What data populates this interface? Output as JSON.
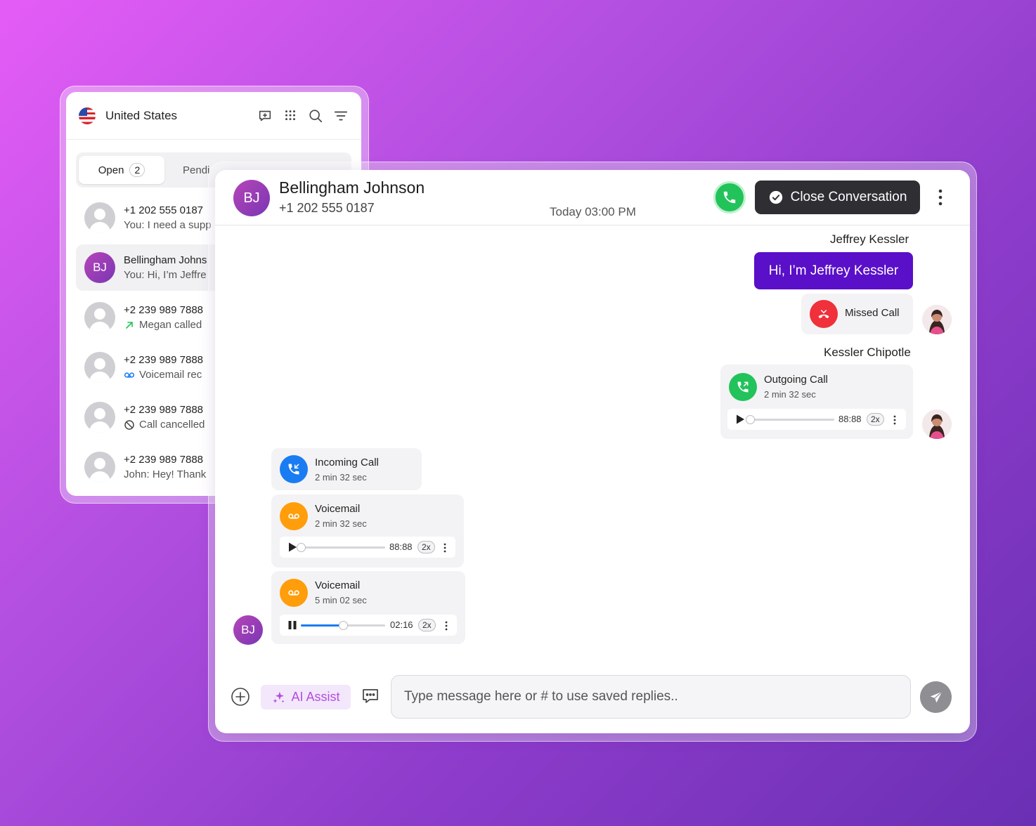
{
  "sidebar": {
    "region": "United States",
    "tabs": [
      {
        "label": "Open",
        "count": "2"
      },
      {
        "label": "Pendi"
      }
    ],
    "conversations": [
      {
        "avatar": "person",
        "name": "+1 202 555 0187",
        "preview": "You: I need a supp",
        "preview_icon": ""
      },
      {
        "avatar": "BJ",
        "name": "Bellingham Johns",
        "preview": "You: Hi, I’m Jeffre",
        "preview_icon": ""
      },
      {
        "avatar": "person",
        "name": "+2 239 989 7888",
        "preview": "Megan called",
        "preview_icon": "outgoing-arrow-icon"
      },
      {
        "avatar": "person",
        "name": "+2 239 989 7888",
        "preview": "Voicemail rec",
        "preview_icon": "voicemail-icon"
      },
      {
        "avatar": "person",
        "name": "+2 239 989 7888",
        "preview": "Call cancelled",
        "preview_icon": "cancelled-icon"
      },
      {
        "avatar": "person",
        "name": "+2 239 989 7888",
        "preview": "John: Hey! Thank",
        "preview_icon": ""
      }
    ]
  },
  "header": {
    "avatar_initials": "BJ",
    "name": "Bellingham Johnson",
    "phone": "+1 202 555 0187",
    "timestamp": "Today 03:00 PM",
    "close_label": "Close Conversation"
  },
  "messages": {
    "sender1": "Jeffrey Kessler",
    "outgoing_text": "Hi, I’m Jeffrey Kessler",
    "missed_call": "Missed Call",
    "sender2": "Kessler Chipotle",
    "outgoing_call": {
      "title": "Outgoing Call",
      "duration": "2 min 32 sec",
      "player_time": "88:88",
      "speed": "2x",
      "progress": 0
    },
    "incoming_call": {
      "title": "Incoming Call",
      "duration": "2 min 32 sec"
    },
    "voicemail1": {
      "title": "Voicemail",
      "duration": "2 min 32 sec",
      "player_time": "88:88",
      "speed": "2x",
      "progress": 0
    },
    "voicemail2": {
      "title": "Voicemail",
      "duration": "5 min 02 sec",
      "player_time": "02:16",
      "speed": "2x",
      "progress": 0.5
    },
    "contact_initials": "BJ"
  },
  "composer": {
    "ai_label": "AI Assist",
    "placeholder": "Type message here or # to use saved replies.."
  },
  "colors": {
    "accent": "#5a0fc8",
    "call_green": "#22c35a",
    "missed_red": "#f0303a",
    "incoming_blue": "#1a7cf2",
    "voicemail_orange": "#ff9d0a"
  }
}
